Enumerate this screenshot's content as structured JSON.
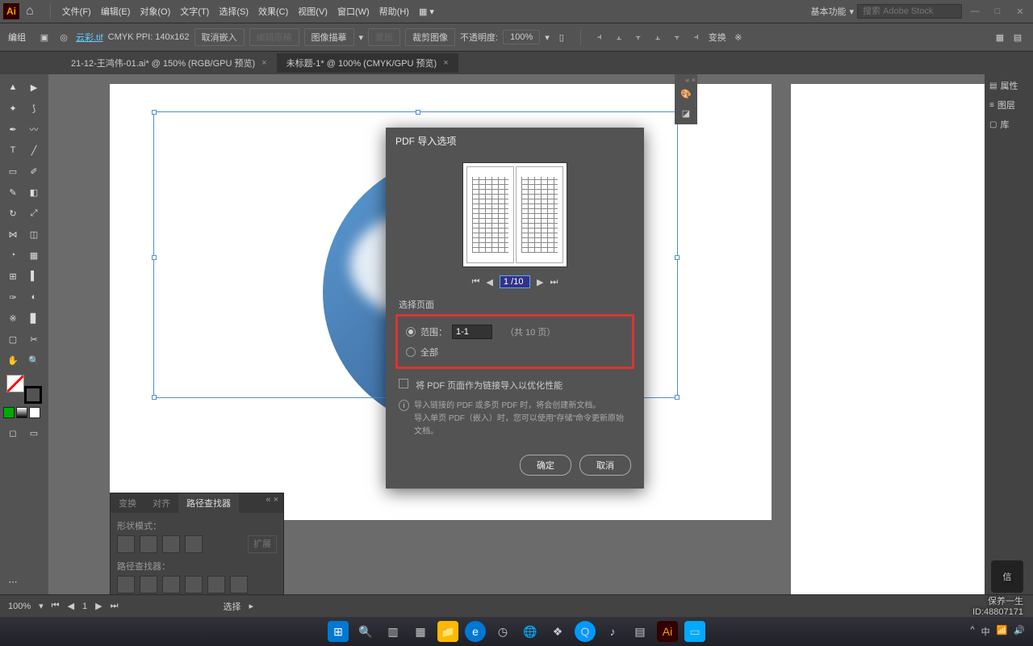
{
  "titlebar": {
    "workspace": "基本功能",
    "search_placeholder": "搜索 Adobe Stock"
  },
  "menu": [
    "文件(F)",
    "编辑(E)",
    "对象(O)",
    "文字(T)",
    "选择(S)",
    "效果(C)",
    "视图(V)",
    "窗口(W)",
    "帮助(H)"
  ],
  "controlbar": {
    "mode": "编组",
    "filename": "云彩.tif",
    "colorinfo": "CMYK PPI: 140x162",
    "cancel_embed": "取消嵌入",
    "edit_original": "编辑原稿",
    "image_desc": "图像描摹",
    "mask": "蒙版",
    "crop": "裁剪图像",
    "opacity_label": "不透明度:",
    "opacity_value": "100%",
    "transform": "变换"
  },
  "tabs": [
    {
      "label": "21-12-王鸿伟-01.ai* @ 150% (RGB/GPU 预览)",
      "active": false
    },
    {
      "label": "未标题-1* @ 100% (CMYK/GPU 预览)",
      "active": true
    }
  ],
  "right_panel": [
    "属性",
    "图层",
    "库"
  ],
  "dialog": {
    "title": "PDF 导入选项",
    "page_value": "1 /10",
    "section": "选择页面",
    "range_label": "范围：",
    "range_value": "1-1",
    "range_total": "（共 10 页）",
    "all_label": "全部",
    "link_checkbox": "将 PDF 页面作为链接导入以优化性能",
    "info1": "导入链接的 PDF 或多页 PDF 时，将会创建新文档。",
    "info2": "导入单页 PDF（嵌入）时，您可以使用\"存储\"命令更新原始文档。",
    "ok": "确定",
    "cancel": "取消"
  },
  "pathfinder": {
    "tabs": [
      "变换",
      "对齐",
      "路径查找器"
    ],
    "shape_mode": "形状模式：",
    "expand": "扩展",
    "pathfinder_label": "路径查找器："
  },
  "status": {
    "zoom": "100%",
    "page": "1",
    "select": "选择"
  },
  "watermark": {
    "brand": "保养一生",
    "id": "ID:48807171"
  }
}
